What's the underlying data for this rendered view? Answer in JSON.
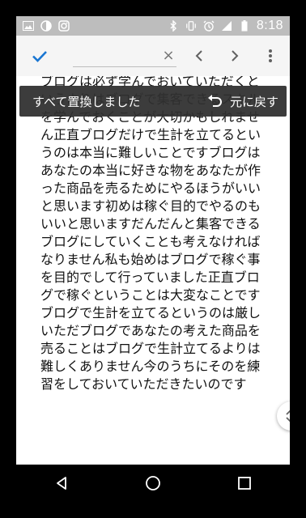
{
  "status_bar": {
    "time": "8:18",
    "icons_left": [
      "image-icon",
      "data-saver-icon",
      "instagram-icon"
    ],
    "icons_right": [
      "bluetooth-icon",
      "vibrate-icon",
      "alarm-icon",
      "signal-icon",
      "battery-icon"
    ]
  },
  "toolbar": {
    "confirm_icon": "check-icon",
    "search_value": "",
    "clear_glyph": "×",
    "prev_icon": "chevron-left-icon",
    "next_icon": "chevron-right-icon",
    "more_icon": "more-vert-icon"
  },
  "snackbar": {
    "message": "すべて置換しました",
    "action_label": "元に戻す"
  },
  "article": {
    "text": "ブログは必ず学んでおいていただくというよりはブログで集客できるスキルを学んでおくことが大切かもしれません正直ブログだけで生計を立てるというのは本当に難しいことですブログはあなたの本当に好きな物をあなたが作った商品を売るためにやるほうがいいと思います初めは稼ぐ目的でやるのもいいと思いますだんだんと集客できるブログにしていくことも考えなければなりません私も始めはブログで稼ぐ事を目的でして行っていました正直ブログで稼ぐということは大変なことですブログで生計を立てるというのは厳しいただブログであなたの考えた商品を売ることはブログで生計立てるよりは難しくありません今のうちにそのを練習をしておいていただきたいのです"
  },
  "colors": {
    "status_bar": "#bdbdbd",
    "toolbar": "#f5f5f5",
    "accent": "#1976d2",
    "snackbar": "#303030"
  }
}
